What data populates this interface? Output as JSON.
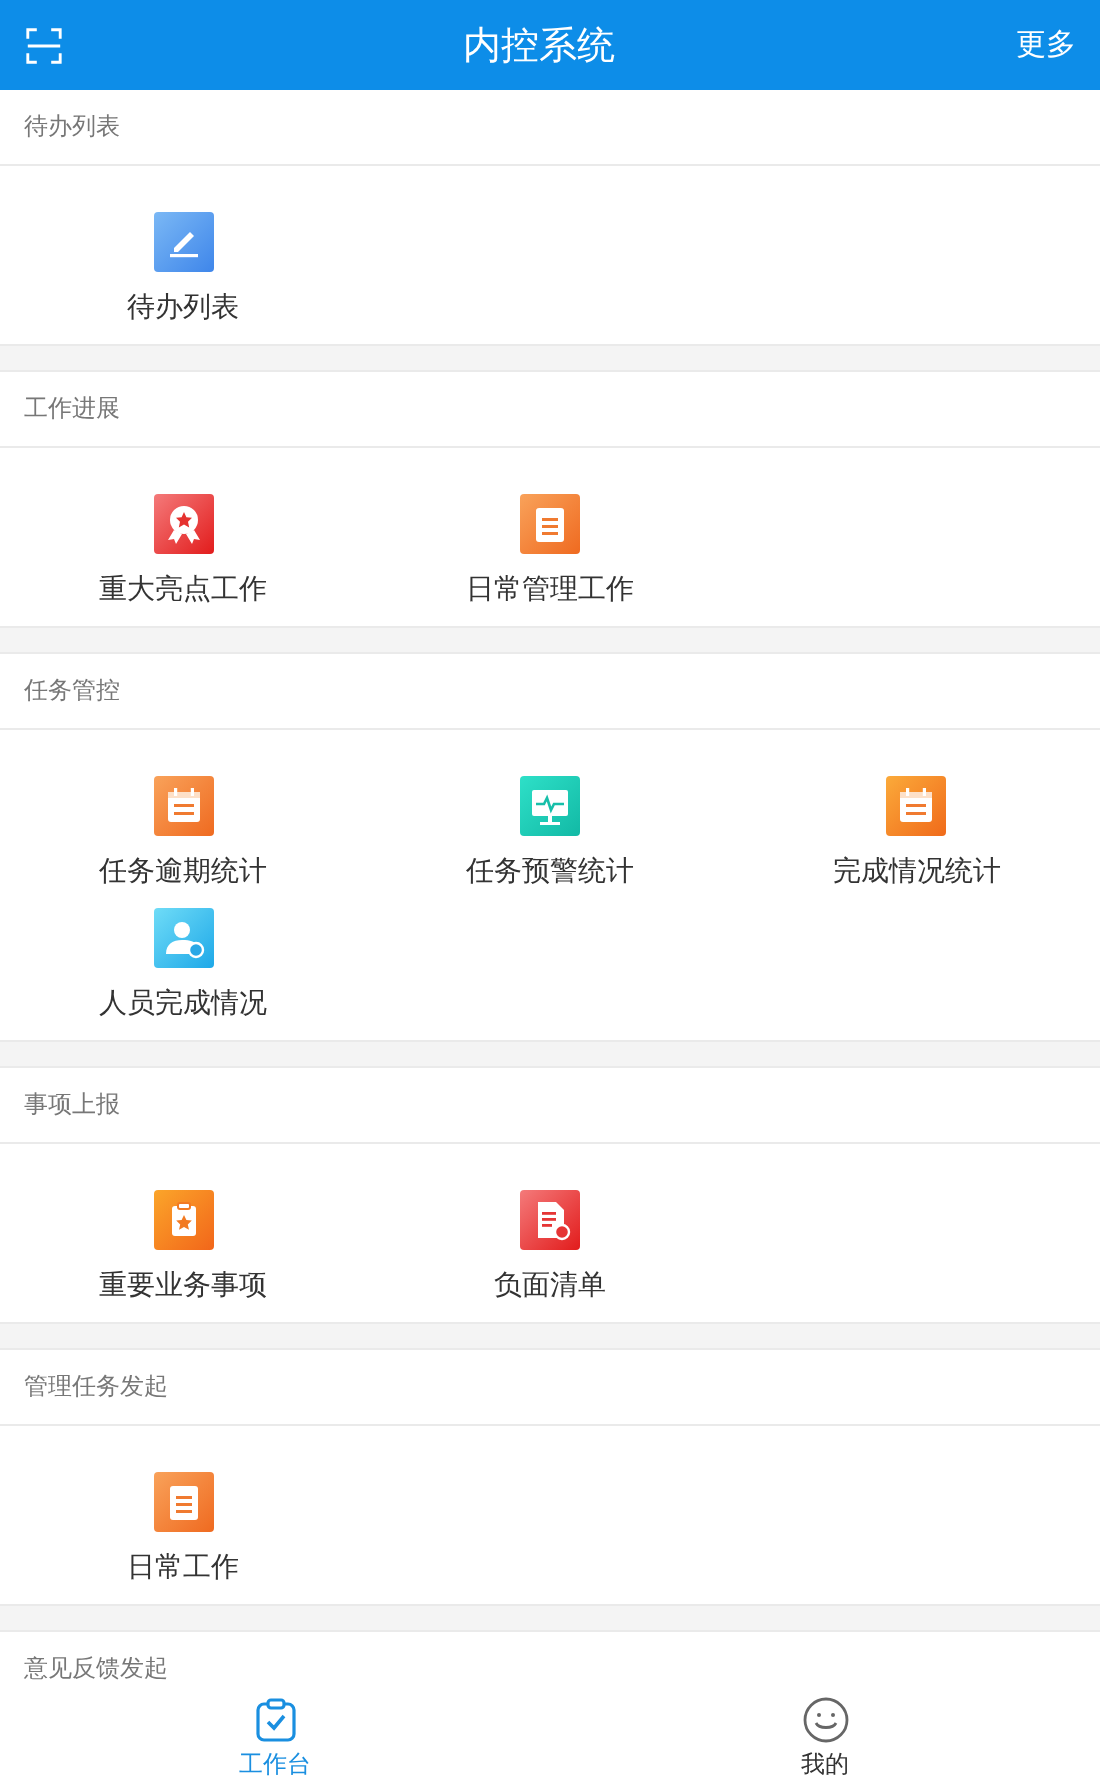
{
  "header": {
    "title": "内控系统",
    "action": "更多"
  },
  "sections": [
    {
      "title": "待办列表",
      "items": [
        {
          "label": "待办列表",
          "kind": "pencil"
        }
      ]
    },
    {
      "title": "工作进展",
      "items": [
        {
          "label": "重大亮点工作",
          "kind": "award"
        },
        {
          "label": "日常管理工作",
          "kind": "clipboard"
        }
      ]
    },
    {
      "title": "任务管控",
      "items": [
        {
          "label": "任务逾期统计",
          "kind": "calendar-mark"
        },
        {
          "label": "任务预警统计",
          "kind": "monitor"
        },
        {
          "label": "完成情况统计",
          "kind": "calendar-list"
        },
        {
          "label": "人员完成情况",
          "kind": "person"
        }
      ]
    },
    {
      "title": "事项上报",
      "items": [
        {
          "label": "重要业务事项",
          "kind": "clipboard-star"
        },
        {
          "label": "负面清单",
          "kind": "document"
        }
      ]
    },
    {
      "title": "管理任务发起",
      "items": [
        {
          "label": "日常工作",
          "kind": "notepad"
        }
      ]
    },
    {
      "title": "意见反馈发起"
    }
  ],
  "tabbar": [
    {
      "label": "工作台",
      "kind": "workbench",
      "selected": true
    },
    {
      "label": "我的",
      "kind": "smiley",
      "selected": false
    }
  ]
}
